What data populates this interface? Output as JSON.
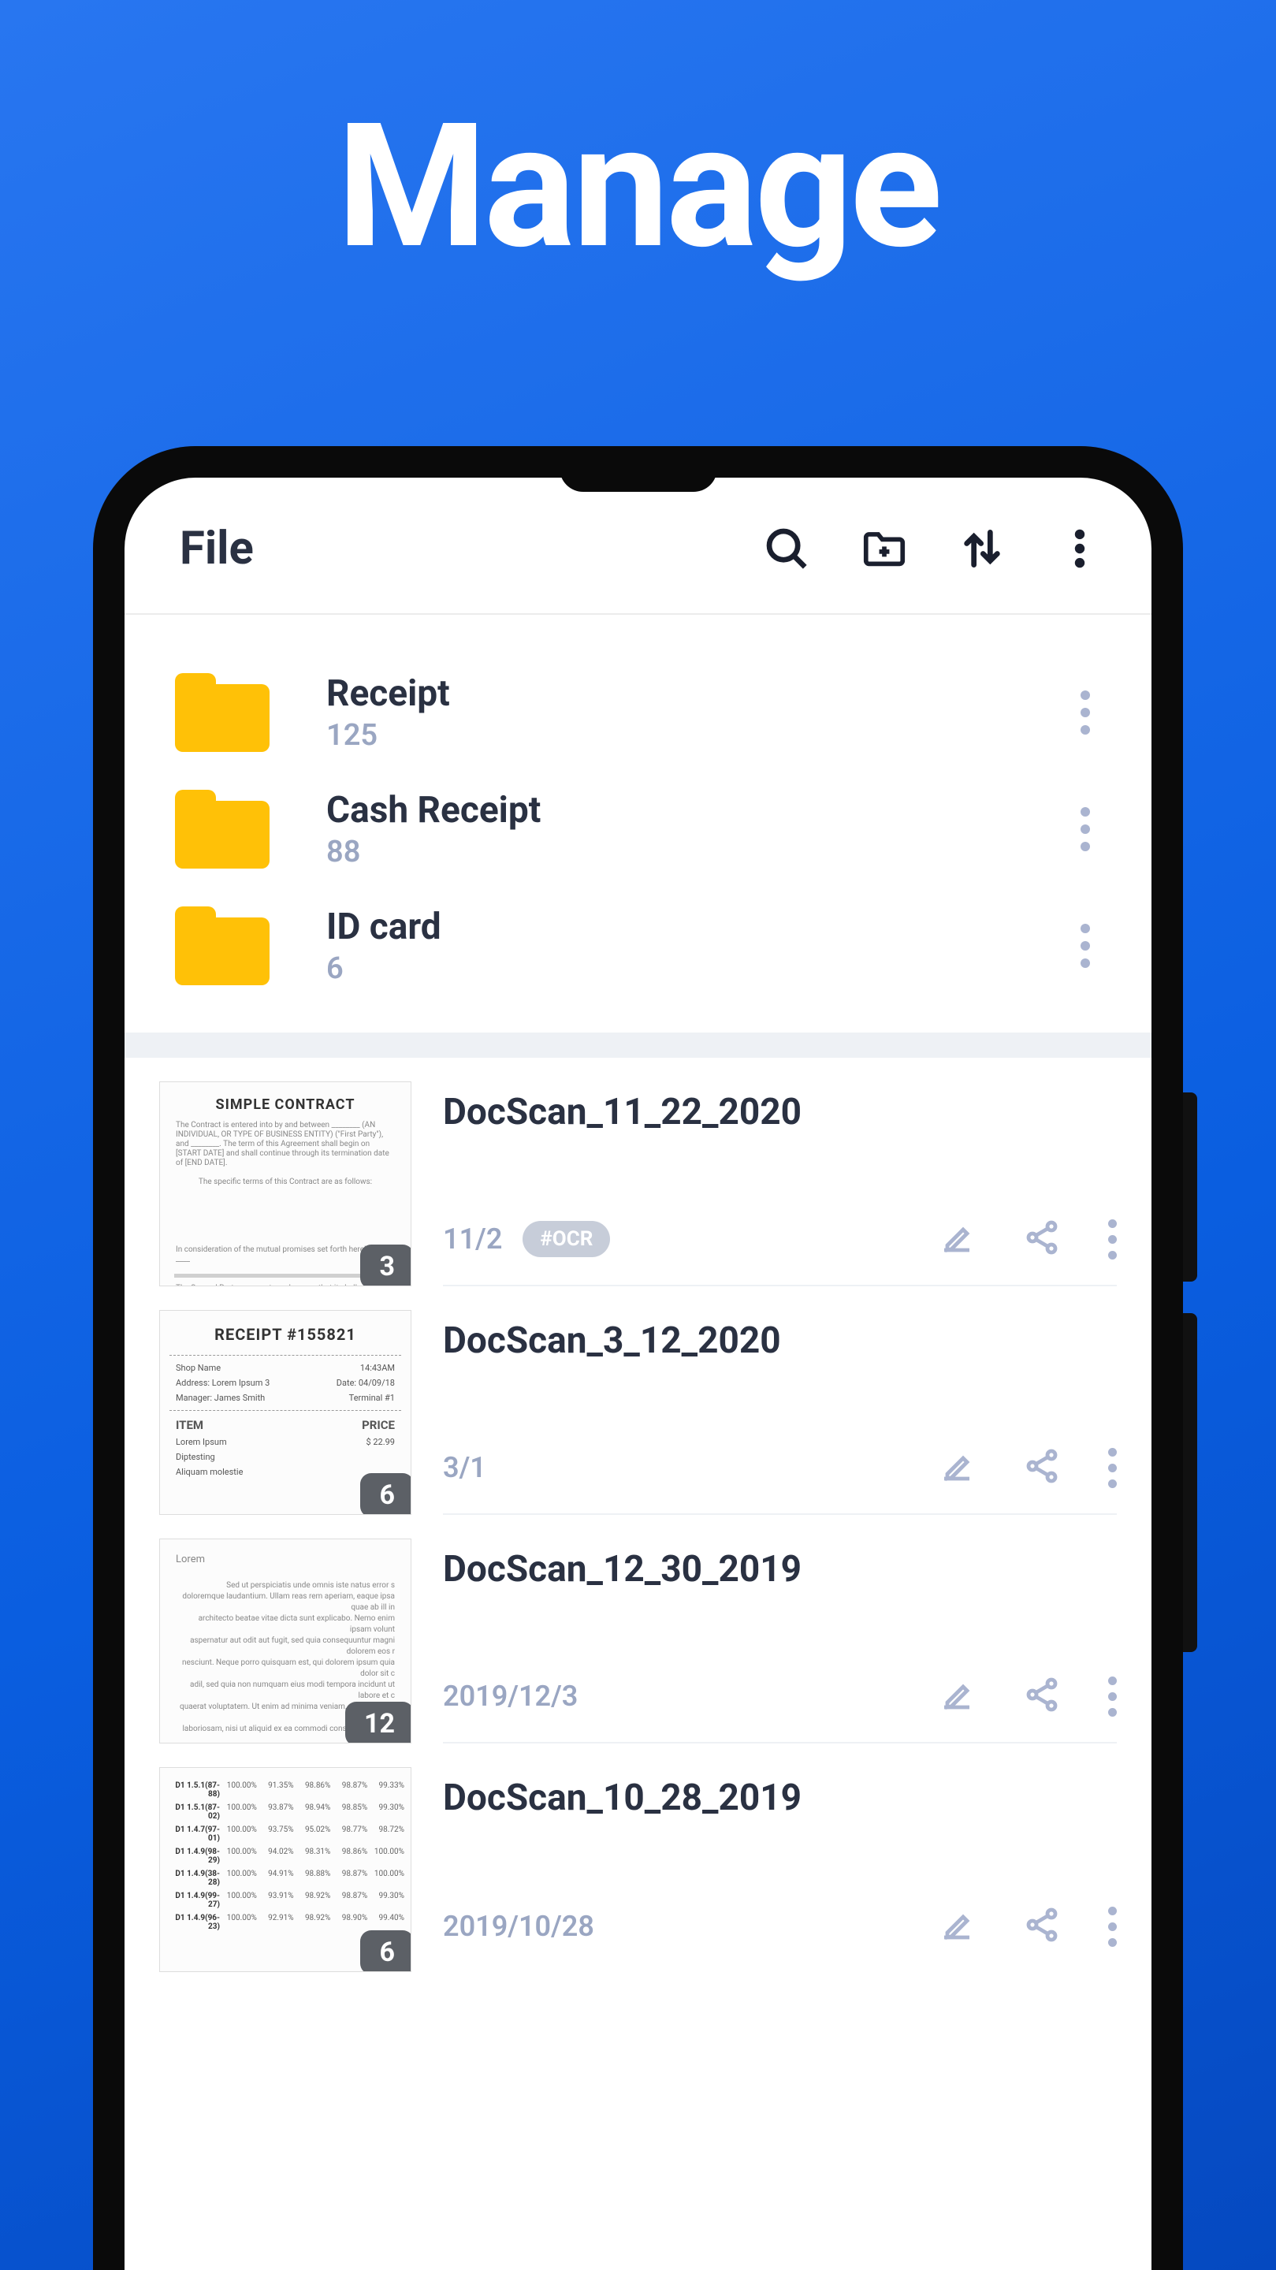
{
  "hero": {
    "title": "Manage"
  },
  "header": {
    "title": "File"
  },
  "folders": [
    {
      "name": "Receipt",
      "count": "125"
    },
    {
      "name": "Cash Receipt",
      "count": "88"
    },
    {
      "name": "ID card",
      "count": "6"
    }
  ],
  "documents": [
    {
      "name": "DocScan_11_22_2020",
      "date": "11/2",
      "pages": "3",
      "ocr": "#OCR",
      "thumb_type": "contract",
      "thumb_title": "SIMPLE CONTRACT"
    },
    {
      "name": "DocScan_3_12_2020",
      "date": "3/1",
      "pages": "6",
      "ocr": "",
      "thumb_type": "receipt",
      "thumb_title": "RECEIPT #155821"
    },
    {
      "name": "DocScan_12_30_2019",
      "date": "2019/12/3",
      "pages": "12",
      "ocr": "",
      "thumb_type": "letter",
      "thumb_title": "Lorem"
    },
    {
      "name": "DocScan_10_28_2019",
      "date": "2019/10/28",
      "pages": "6",
      "ocr": "",
      "thumb_type": "table",
      "thumb_title": ""
    }
  ],
  "thumbs": {
    "receipt_rows": [
      [
        "Shop Name",
        "14:43AM"
      ],
      [
        "Address: Lorem Ipsum 3",
        "Date: 04/09/18"
      ],
      [
        "Manager: James Smith",
        "Terminal #1"
      ]
    ],
    "receipt_items_header": [
      "ITEM",
      "PRICE"
    ],
    "receipt_items": [
      [
        "Lorem Ipsum",
        "$ 22.99"
      ],
      [
        "Diptesting",
        ""
      ],
      [
        "Aliquam molestie",
        ""
      ]
    ],
    "table_rows": [
      [
        "D1 1.5.1(87-88)",
        "100.00%",
        "91.35%",
        "98.86%",
        "98.87%",
        "99.33%"
      ],
      [
        "D1 1.5.1(87-02)",
        "100.00%",
        "93.87%",
        "98.94%",
        "98.85%",
        "99.30%"
      ],
      [
        "D1 1.4.7(97-01)",
        "100.00%",
        "93.75%",
        "95.02%",
        "98.77%",
        "98.72%"
      ],
      [
        "D1 1.4.9(98-29)",
        "100.00%",
        "94.02%",
        "98.31%",
        "98.86%",
        "100.00%"
      ],
      [
        "D1 1.4.9(38-28)",
        "100.00%",
        "94.91%",
        "98.88%",
        "98.87%",
        "100.00%"
      ],
      [
        "D1 1.4.9(99-27)",
        "100.00%",
        "93.91%",
        "98.92%",
        "98.87%",
        "99.30%"
      ],
      [
        "D1 1.4.9(96-23)",
        "100.00%",
        "92.91%",
        "98.92%",
        "98.90%",
        "99.40%"
      ]
    ]
  }
}
